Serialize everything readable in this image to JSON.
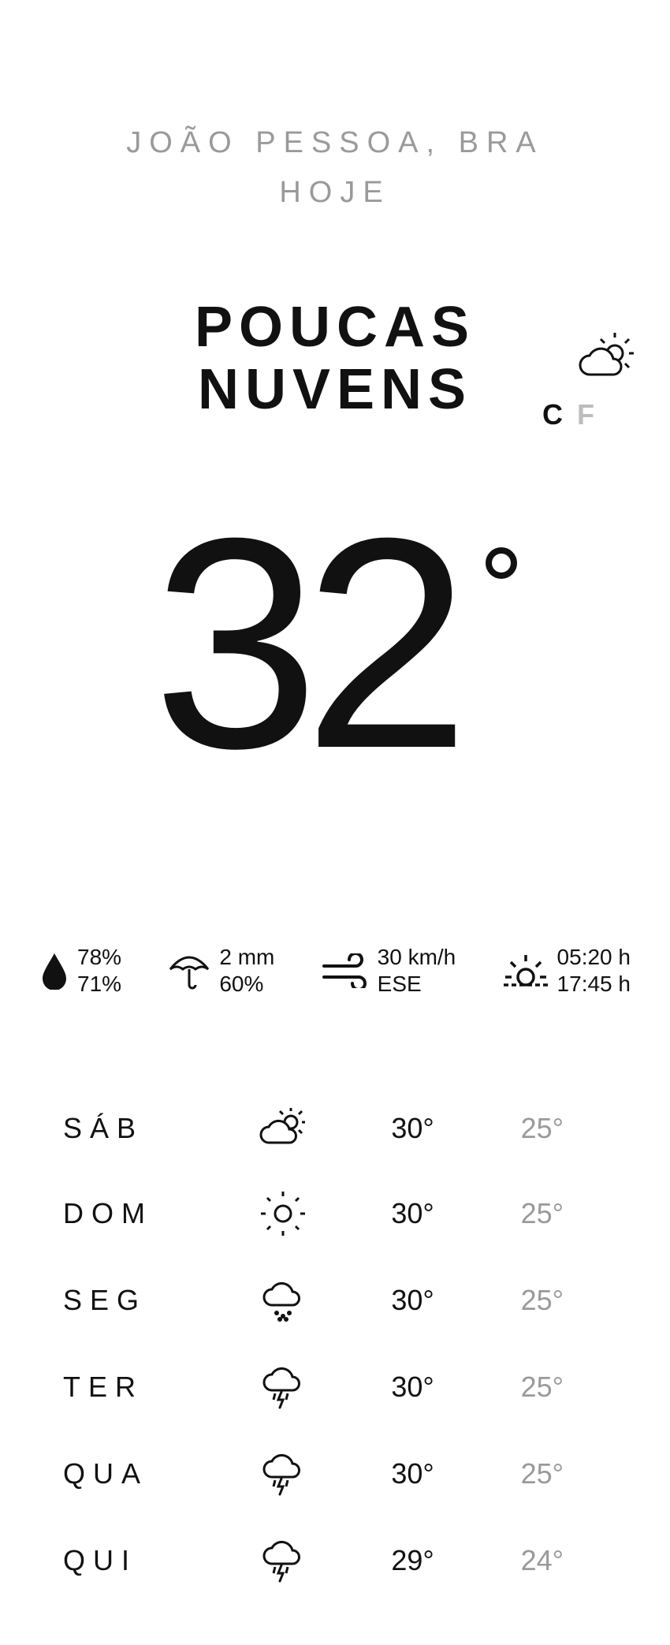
{
  "header": {
    "location": "JOÃO PESSOA, BRA",
    "today": "HOJE"
  },
  "current": {
    "condition": "POUCAS NUVENS",
    "temp": "32",
    "unit_c": "C",
    "unit_f": "F",
    "icon": "partly-cloudy"
  },
  "metrics": {
    "humidity": {
      "top": "78%",
      "bottom": "71%"
    },
    "rain": {
      "top": "2 mm",
      "bottom": "60%"
    },
    "wind": {
      "top": "30 km/h",
      "bottom": "ESE"
    },
    "sun": {
      "top": "05:20 h",
      "bottom": "17:45 h"
    }
  },
  "forecast": [
    {
      "day": "SÁB",
      "icon": "partly-cloudy",
      "hi": "30°",
      "lo": "25°"
    },
    {
      "day": "DOM",
      "icon": "sunny",
      "hi": "30°",
      "lo": "25°"
    },
    {
      "day": "SEG",
      "icon": "rain",
      "hi": "30°",
      "lo": "25°"
    },
    {
      "day": "TER",
      "icon": "thunder",
      "hi": "30°",
      "lo": "25°"
    },
    {
      "day": "QUA",
      "icon": "thunder",
      "hi": "30°",
      "lo": "25°"
    },
    {
      "day": "QUI",
      "icon": "thunder",
      "hi": "29°",
      "lo": "24°"
    }
  ]
}
